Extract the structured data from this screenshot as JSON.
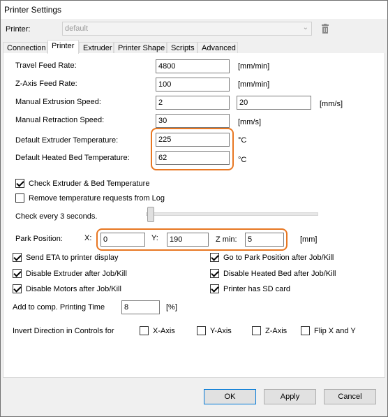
{
  "window": {
    "title": "Printer Settings"
  },
  "printer": {
    "label": "Printer:",
    "value": "default"
  },
  "tabs": [
    {
      "label": "Connection"
    },
    {
      "label": "Printer"
    },
    {
      "label": "Extruder"
    },
    {
      "label": "Printer Shape"
    },
    {
      "label": "Scripts"
    },
    {
      "label": "Advanced"
    }
  ],
  "fields": {
    "travel_feed_rate": {
      "label": "Travel Feed Rate:",
      "value": "4800",
      "unit": "[mm/min]"
    },
    "z_axis_feed_rate": {
      "label": "Z-Axis Feed Rate:",
      "value": "100",
      "unit": "[mm/min]"
    },
    "manual_extrusion_speed": {
      "label": "Manual Extrusion Speed:",
      "value1": "2",
      "value2": "20",
      "unit": "[mm/s]"
    },
    "manual_retraction_speed": {
      "label": "Manual Retraction Speed:",
      "value": "30",
      "unit": "[mm/s]"
    },
    "default_extruder_temp": {
      "label": "Default Extruder Temperature:",
      "value": "225",
      "unit": "°C"
    },
    "default_bed_temp": {
      "label": "Default Heated Bed Temperature:",
      "value": "62",
      "unit": "°C"
    }
  },
  "checks": {
    "check_temperature": {
      "label": "Check Extruder & Bed Temperature",
      "checked": true
    },
    "remove_temp_requests": {
      "label": "Remove temperature requests from Log",
      "checked": false
    }
  },
  "check_every": {
    "label": "Check every 3 seconds.",
    "value": 3
  },
  "park": {
    "label": "Park Position:",
    "x_label": "X:",
    "x_value": "0",
    "y_label": "Y:",
    "y_value": "190",
    "zmin_label": "Z min:",
    "zmin_value": "5",
    "unit": "[mm]"
  },
  "options": {
    "send_eta": {
      "label": "Send ETA to printer display",
      "checked": true
    },
    "go_to_park": {
      "label": "Go to Park Position after Job/Kill",
      "checked": true
    },
    "disable_extruder": {
      "label": "Disable Extruder after Job/Kill",
      "checked": true
    },
    "disable_heated_bed": {
      "label": "Disable Heated Bed after Job/Kill",
      "checked": true
    },
    "disable_motors": {
      "label": "Disable Motors after Job/Kill",
      "checked": true
    },
    "has_sd_card": {
      "label": "Printer has SD card",
      "checked": true
    }
  },
  "printing_time": {
    "label": "Add to comp. Printing Time",
    "value": "8",
    "unit": "[%]"
  },
  "invert": {
    "label": "Invert Direction in Controls for",
    "x_axis": "X-Axis",
    "y_axis": "Y-Axis",
    "z_axis": "Z-Axis",
    "flip": "Flip X and Y"
  },
  "buttons": {
    "ok": "OK",
    "apply": "Apply",
    "cancel": "Cancel"
  },
  "colors": {
    "highlight": "#e87722"
  }
}
